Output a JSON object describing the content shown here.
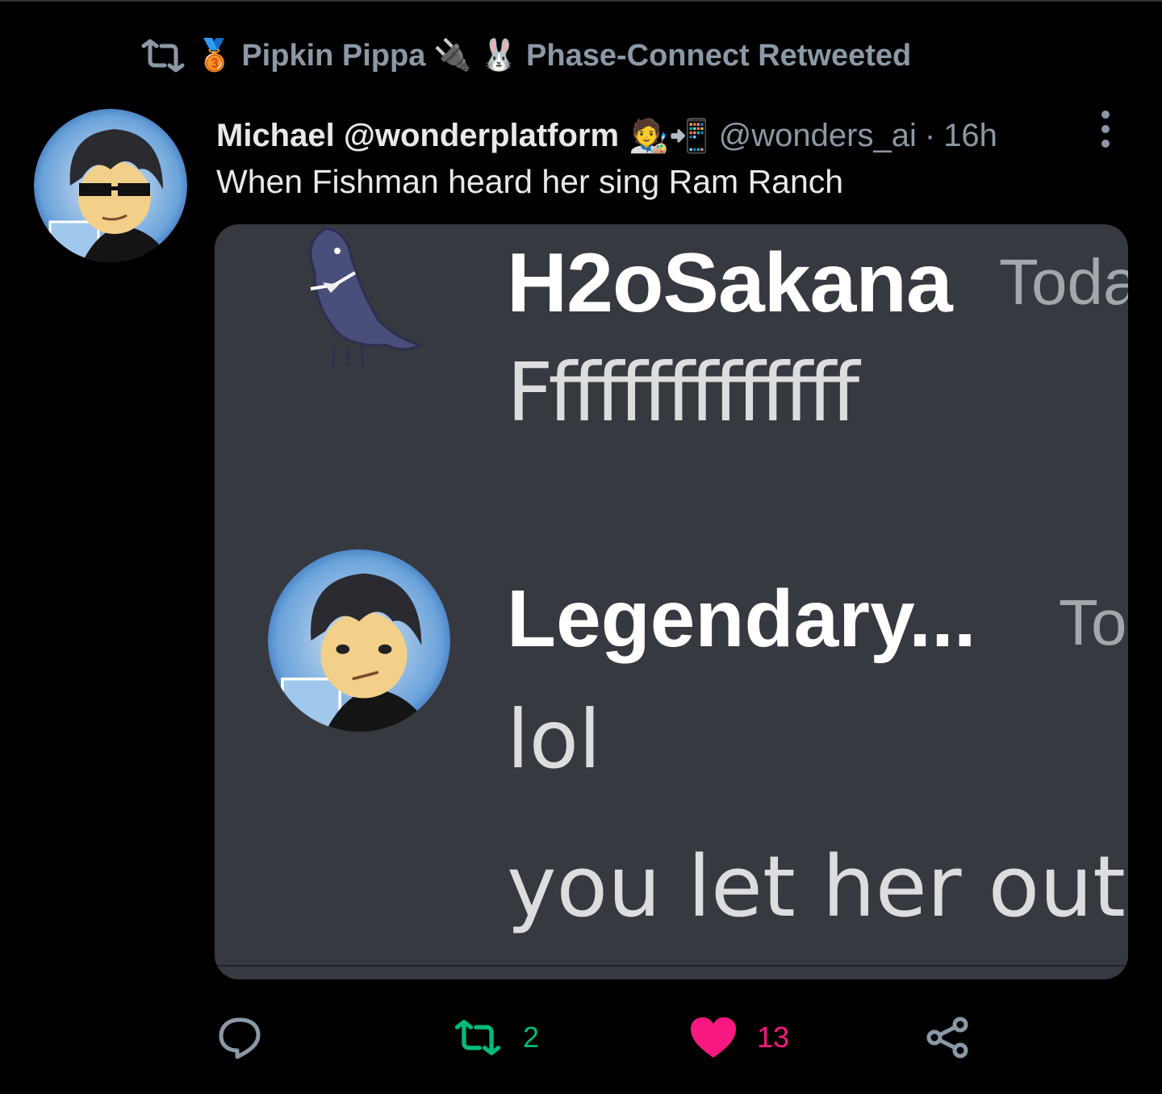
{
  "social_context": {
    "retweeter_name": "Pipkin Pippa",
    "suffix": "Phase-Connect Retweeted",
    "emoji_medal": "🥉",
    "emoji_plug": "🔌",
    "emoji_rabbit": "🐰"
  },
  "tweet": {
    "author_name": "Michael @wonderplatform",
    "author_emojis": "🧑‍🎨📲",
    "handle": "@wonders_ai",
    "separator": "·",
    "time": "16h",
    "text": "When Fishman heard her sing Ram Ranch"
  },
  "media": {
    "messages": [
      {
        "author": "H2oSakana",
        "time": "Toda",
        "text": "Ffffffffffffff"
      },
      {
        "author": "Legendary...",
        "time": "To",
        "text": "lol"
      },
      {
        "text": "you let her out"
      }
    ]
  },
  "actions": {
    "reply_count": "",
    "retweet_count": "2",
    "like_count": "13"
  },
  "colors": {
    "background": "#000000",
    "text_primary": "#e7e9ea",
    "text_secondary": "#8b98a5",
    "retweet_green": "#00ba7c",
    "like_pink": "#f91880",
    "discord_bg": "#36393f"
  },
  "icons": {
    "retweet": "retweet-icon",
    "more": "more-icon",
    "reply": "reply-icon",
    "like": "heart-icon",
    "share": "share-icon"
  }
}
